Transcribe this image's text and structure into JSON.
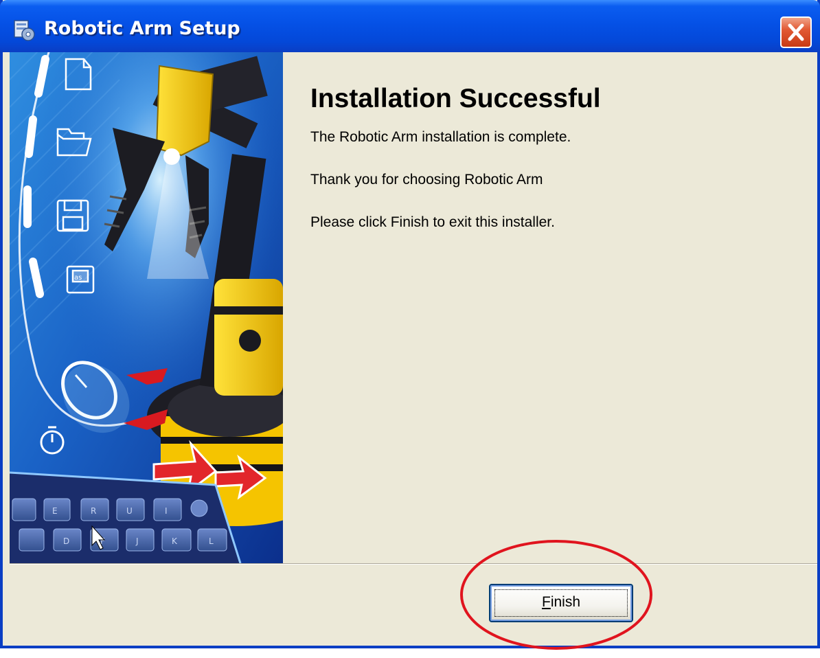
{
  "window": {
    "title": "Robotic Arm Setup",
    "title_icon": "setup-installer-icon",
    "close_icon": "close-icon",
    "colors": {
      "titlebar": "#0551e6",
      "close_button": "#e25a34",
      "dialog_bg": "#ece9d8",
      "annotation": "#e0141e"
    }
  },
  "content": {
    "heading": "Installation Successful",
    "message_complete": "The Robotic Arm installation is complete.",
    "message_thanks": "Thank you for choosing Robotic Arm",
    "message_exit": "Please click Finish to exit this installer."
  },
  "side_image": {
    "description_icons": [
      "document-icon",
      "folder-icon",
      "floppy-disk-icon",
      "save-as-icon",
      "mouse-icon",
      "timer-icon"
    ],
    "keyboard_keys": [
      "E",
      "R",
      "U",
      "I",
      "D",
      "F",
      "J",
      "K",
      "L"
    ]
  },
  "footer": {
    "finish_label_first": "F",
    "finish_label_rest": "inish"
  }
}
